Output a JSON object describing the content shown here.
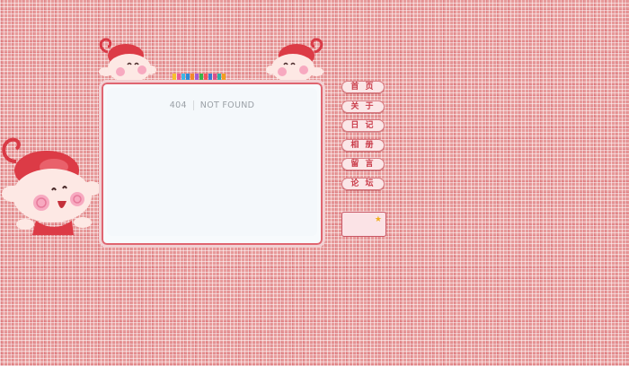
{
  "error": {
    "code": "404",
    "text": "NOT FOUND"
  },
  "nav": {
    "items": [
      "首 页",
      "关 于",
      "日 记",
      "相 册",
      "留 言",
      "论 坛"
    ]
  },
  "badge": {
    "line1": "",
    "line2": ""
  },
  "colors": {
    "background": "#e79a9a",
    "panel": "#f7fafc",
    "accent": "#c93a48",
    "colorbar": [
      "#f7c22b",
      "#e95b9a",
      "#3fb7e6",
      "#2a8dd8",
      "#f08a2c",
      "#a35bd6",
      "#39b54a",
      "#f5515f",
      "#3a7bd5",
      "#d94f8c",
      "#2fb0a8",
      "#f0a020"
    ]
  },
  "icons": [
    "monkey-mascot-icon",
    "monkey-peek-left-icon",
    "monkey-peek-right-icon"
  ]
}
